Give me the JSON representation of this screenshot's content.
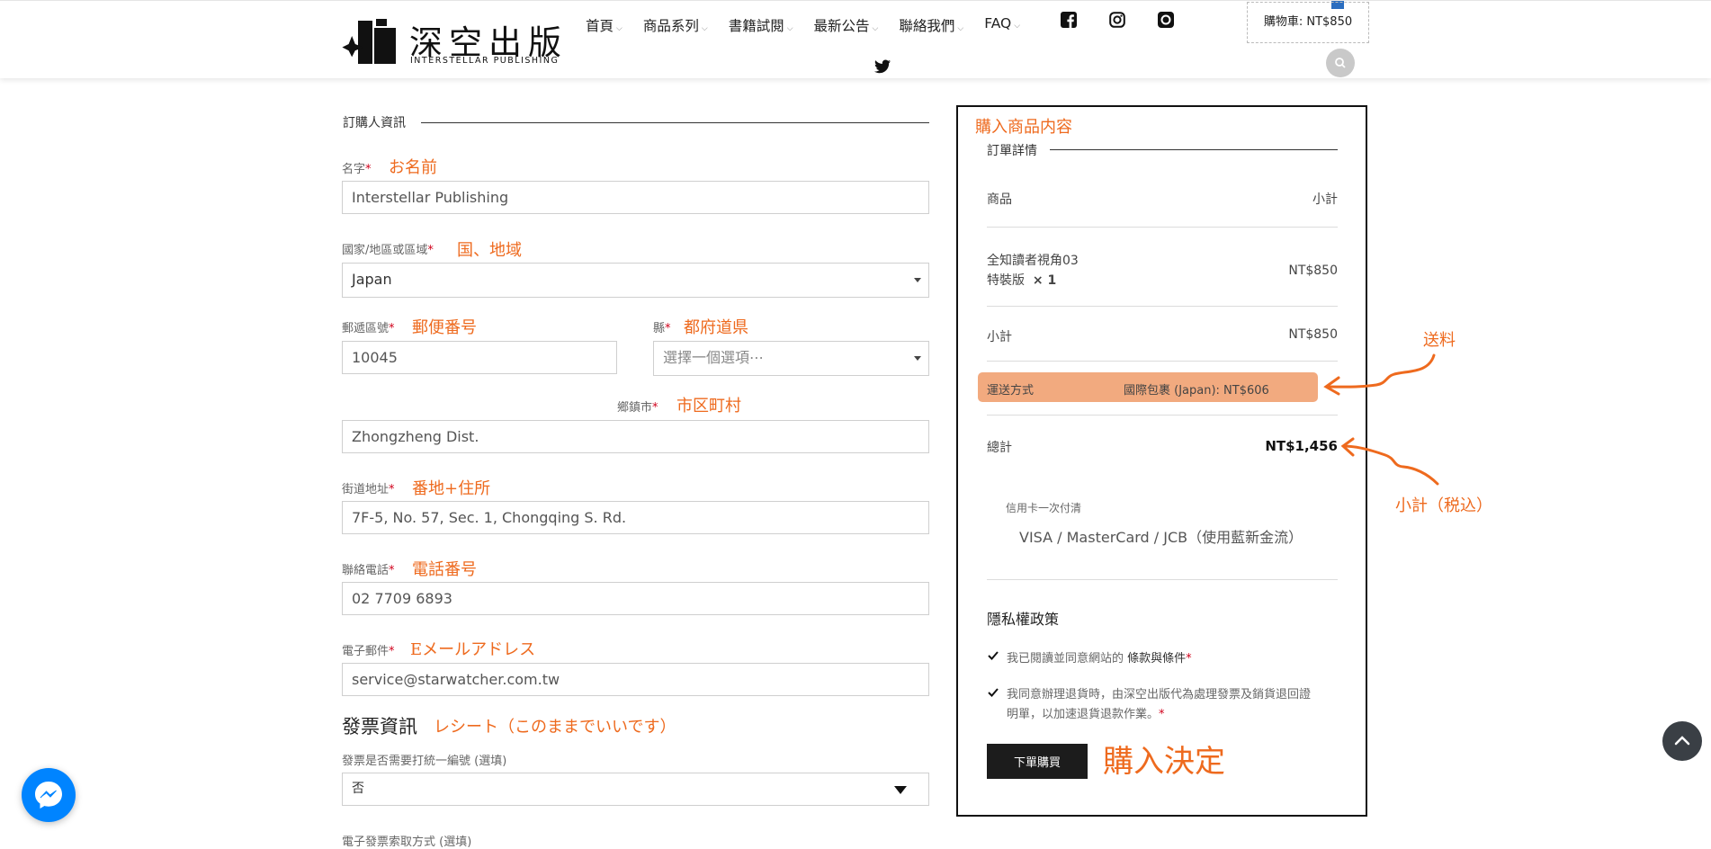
{
  "header": {
    "logo_cn": "深空出版",
    "logo_en": "INTERSTELLAR PUBLISHING",
    "nav": [
      {
        "label": "首頁",
        "has_dropdown": true
      },
      {
        "label": "商品系列",
        "has_dropdown": true
      },
      {
        "label": "書籍試閱",
        "has_dropdown": true
      },
      {
        "label": "最新公告",
        "has_dropdown": true
      },
      {
        "label": "聯絡我們",
        "has_dropdown": true
      },
      {
        "label": "FAQ",
        "has_dropdown": true
      }
    ],
    "social_icons": [
      "facebook-icon",
      "instagram-icon",
      "plurk-icon",
      "twitter-icon"
    ],
    "cart_label": "購物車: NT$850"
  },
  "billing": {
    "section_title": "訂購人資訊",
    "name": {
      "label": "名字",
      "required": "*",
      "note": "お名前",
      "value": "Interstellar Publishing"
    },
    "country": {
      "label": "國家/地區或區域",
      "required": "*",
      "note": "国、地域",
      "value": "Japan"
    },
    "postcode": {
      "label": "郵遞區號",
      "required": "*",
      "note": "郵便番号",
      "value": "10045"
    },
    "county": {
      "label": "縣",
      "required": "*",
      "note": "都府道県",
      "placeholder": "選擇一個選項⋯"
    },
    "city": {
      "label": "鄉鎮市",
      "required": "*",
      "note": "市区町村",
      "value": "Zhongzheng Dist."
    },
    "street": {
      "label": "街道地址",
      "required": "*",
      "note": "番地+住所",
      "value": "7F-5, No. 57, Sec. 1, Chongqing S. Rd."
    },
    "phone": {
      "label": "聯絡電話",
      "required": "*",
      "note": "電話番号",
      "value": "02 7709 6893"
    },
    "email": {
      "label": "電子郵件",
      "required": "*",
      "note": "Eメールアドレス",
      "value": "service@starwatcher.com.tw"
    }
  },
  "invoice": {
    "heading": "發票資訊",
    "note": "レシート（このままでいいです）",
    "tax_id_label": "發票是否需要打統一編號 (選填)",
    "tax_id_value": "否",
    "carrier_label": "電子發票索取方式 (選填)"
  },
  "order": {
    "annotation": "購入商品内容",
    "section_title": "訂單詳情",
    "col_product": "商品",
    "col_subtotal": "小計",
    "item_name_line1": "全知讀者視角03",
    "item_name_line2": "特裝版",
    "item_qty": "× 1",
    "item_price": "NT$850",
    "subtotal_label": "小計",
    "subtotal_value": "NT$850",
    "shipping_label": "運送方式",
    "shipping_value": "國際包裹 (Japan): NT$606",
    "total_label": "總計",
    "total_value": "NT$1,456",
    "payment_label": "信用卡一次付清",
    "payment_desc": "VISA / MasterCard / JCB（使用藍新金流）",
    "privacy_heading": "隱私權政策",
    "terms_pre": "我已閱讀並同意網站的",
    "terms_link": "條款與條件",
    "terms_req": "*",
    "refund_line1": "我同意辦理退貨時，由深空出版代為處理發票及銷貨退回證",
    "refund_line2": "明單，以加速退貨退款作業。",
    "refund_req": "*",
    "buy_button": "下單購買",
    "buy_note": "購入決定"
  },
  "annotations": {
    "shipping_note": "送料",
    "total_note": "小計（税込）"
  },
  "colors": {
    "annotation": "#ee6a1e",
    "shipping_highlight": "#f2aa7f",
    "button": "#1c1c1c",
    "required": "#d0021b"
  }
}
